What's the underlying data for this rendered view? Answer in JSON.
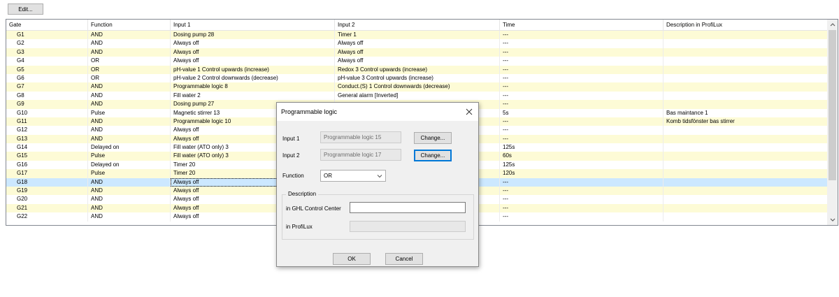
{
  "toolbar": {
    "edit_label": "Edit..."
  },
  "table": {
    "columns": [
      "Gate",
      "Function",
      "Input 1",
      "Input 2",
      "Time",
      "Description in ProfiLux"
    ],
    "rows": [
      {
        "gate": "G1",
        "function": "AND",
        "input1": "Dosing pump 28",
        "input2": "Timer 1",
        "time": "---",
        "desc": ""
      },
      {
        "gate": "G2",
        "function": "AND",
        "input1": "Always off",
        "input2": "Always off",
        "time": "---",
        "desc": ""
      },
      {
        "gate": "G3",
        "function": "AND",
        "input1": "Always off",
        "input2": "Always off",
        "time": "---",
        "desc": ""
      },
      {
        "gate": "G4",
        "function": "OR",
        "input1": "Always off",
        "input2": "Always off",
        "time": "---",
        "desc": ""
      },
      {
        "gate": "G5",
        "function": "OR",
        "input1": "pH-value 1 Control upwards (increase)",
        "input2": "Redox 3 Control upwards (increase)",
        "time": "---",
        "desc": ""
      },
      {
        "gate": "G6",
        "function": "OR",
        "input1": "pH-value 2 Control downwards (decrease)",
        "input2": "pH-value 3 Control upwards (increase)",
        "time": "---",
        "desc": ""
      },
      {
        "gate": "G7",
        "function": "AND",
        "input1": "Programmable logic 8",
        "input2": "Conduct.(S) 1 Control downwards (decrease)",
        "time": "---",
        "desc": ""
      },
      {
        "gate": "G8",
        "function": "AND",
        "input1": "Fill water 2",
        "input2": "General alarm [Inverted]",
        "time": "---",
        "desc": ""
      },
      {
        "gate": "G9",
        "function": "AND",
        "input1": "Dosing pump 27",
        "input2": "",
        "time": "---",
        "desc": ""
      },
      {
        "gate": "G10",
        "function": "Pulse",
        "input1": "Magnetic stirrer 13",
        "input2": "",
        "time": "5s",
        "desc": "Bas maintance 1"
      },
      {
        "gate": "G11",
        "function": "AND",
        "input1": "Programmable logic 10",
        "input2": "",
        "time": "---",
        "desc": "Komb tidsfönster bas stirrer"
      },
      {
        "gate": "G12",
        "function": "AND",
        "input1": "Always off",
        "input2": "",
        "time": "---",
        "desc": ""
      },
      {
        "gate": "G13",
        "function": "AND",
        "input1": "Always off",
        "input2": "",
        "time": "---",
        "desc": ""
      },
      {
        "gate": "G14",
        "function": "Delayed on",
        "input1": "Fill water (ATO only) 3",
        "input2": "",
        "time": "125s",
        "desc": ""
      },
      {
        "gate": "G15",
        "function": "Pulse",
        "input1": "Fill water (ATO only) 3",
        "input2": "",
        "time": "60s",
        "desc": ""
      },
      {
        "gate": "G16",
        "function": "Delayed on",
        "input1": "Timer 20",
        "input2": "",
        "time": "125s",
        "desc": ""
      },
      {
        "gate": "G17",
        "function": "Pulse",
        "input1": "Timer 20",
        "input2": "",
        "time": "120s",
        "desc": ""
      },
      {
        "gate": "G18",
        "function": "AND",
        "input1": "Always off",
        "input2": "",
        "time": "---",
        "desc": ""
      },
      {
        "gate": "G19",
        "function": "AND",
        "input1": "Always off",
        "input2": "",
        "time": "---",
        "desc": ""
      },
      {
        "gate": "G20",
        "function": "AND",
        "input1": "Always off",
        "input2": "",
        "time": "---",
        "desc": ""
      },
      {
        "gate": "G21",
        "function": "AND",
        "input1": "Always off",
        "input2": "",
        "time": "---",
        "desc": ""
      },
      {
        "gate": "G22",
        "function": "AND",
        "input1": "Always off",
        "input2": "",
        "time": "---",
        "desc": ""
      }
    ],
    "selected_gate": "G18"
  },
  "dialog": {
    "title": "Programmable logic",
    "input1_label": "Input 1",
    "input1_value": "Programmable logic 15",
    "input2_label": "Input 2",
    "input2_value": "Programmable logic 17",
    "change_label": "Change...",
    "function_label": "Function",
    "function_value": "OR",
    "description_legend": "Description",
    "ghl_label": "in GHL Control Center",
    "ghl_value": "",
    "proflux_label": "in ProfiLux",
    "proflux_value": "",
    "ok_label": "OK",
    "cancel_label": "Cancel"
  },
  "icons": {
    "close": "close-icon",
    "chevron_down": "chevron-down-icon",
    "scroll_up": "scroll-up-arrow-icon",
    "scroll_down": "scroll-down-arrow-icon"
  },
  "colors": {
    "row_alt": "#fdfbd6",
    "row_selected": "#cce8ff",
    "focus_border": "#0078d7"
  }
}
